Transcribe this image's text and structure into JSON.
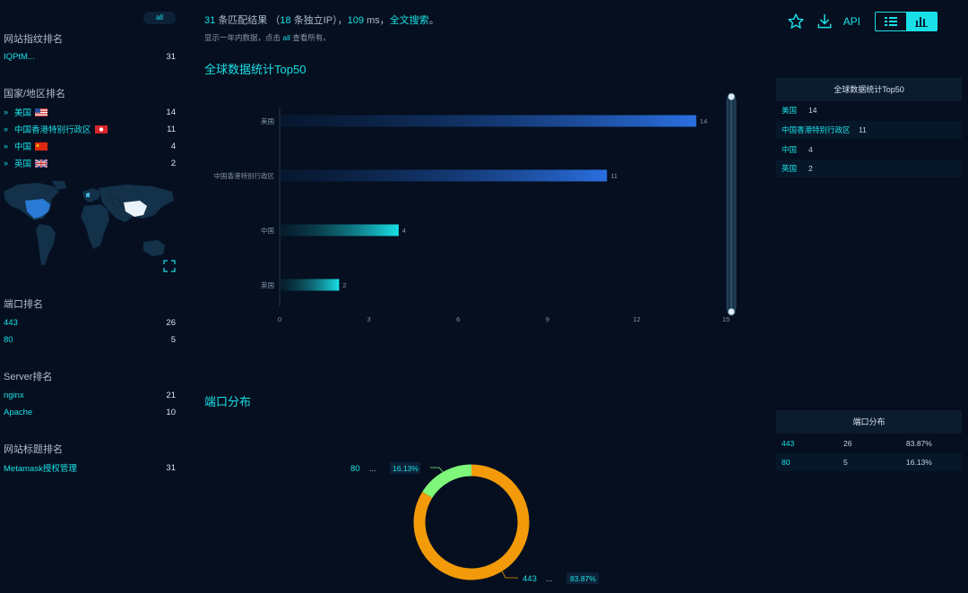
{
  "left": {
    "all_pill": "all",
    "fingerprint": {
      "title": "网站指纹排名",
      "items": [
        {
          "label": "IQPtM...",
          "count": "31"
        }
      ]
    },
    "country": {
      "title": "国家/地区排名",
      "items": [
        {
          "label": "美国",
          "count": "14",
          "flag": "us-flag-icon"
        },
        {
          "label": "中国香港特别行政区",
          "count": "11",
          "flag": "hk-flag-icon"
        },
        {
          "label": "中国",
          "count": "4",
          "flag": "cn-flag-icon"
        },
        {
          "label": "英国",
          "count": "2",
          "flag": "uk-flag-icon"
        }
      ]
    },
    "port": {
      "title": "端口排名",
      "items": [
        {
          "label": "443",
          "count": "26"
        },
        {
          "label": "80",
          "count": "5"
        }
      ]
    },
    "server": {
      "title": "Server排名",
      "items": [
        {
          "label": "nginx",
          "count": "21"
        },
        {
          "label": "Apache",
          "count": "10"
        }
      ]
    },
    "site_title": {
      "title": "网站标题排名",
      "items": [
        {
          "label": "Metamask授权管理",
          "count": "31"
        }
      ]
    }
  },
  "header": {
    "count": "31",
    "matched": "条匹配结果",
    "paren_open": "（",
    "ip_count": "18",
    "ip_text": "条独立IP",
    "paren_close": "）",
    "sep": "，",
    "ms": "109",
    "ms_text": "ms，",
    "fulltext": "全文搜索",
    "end": "。",
    "note_prefix": "显示一年内数据，点击",
    "note_all": "all",
    "note_suffix": "查看所有。"
  },
  "toolbar": {
    "api_label": "API",
    "icons": [
      "star-icon",
      "download-icon",
      "list-view-icon",
      "chart-view-icon"
    ]
  },
  "chart_titles": {
    "global": "全球数据统计Top50",
    "port": "端口分布"
  },
  "chart_data": [
    {
      "type": "bar",
      "orientation": "horizontal",
      "categories": [
        "美国",
        "中国香港特别行政区",
        "中国",
        "英国"
      ],
      "values": [
        14,
        11,
        4,
        2
      ],
      "xticks": [
        0,
        3,
        6,
        9,
        12,
        15
      ],
      "xlim": [
        0,
        15
      ],
      "title": "全球数据统计Top50"
    },
    {
      "type": "pie",
      "donut": true,
      "labels": [
        "443",
        "80"
      ],
      "values": [
        26,
        5
      ],
      "percent_labels": [
        "83.87%",
        "16.13%"
      ],
      "colors": [
        "#f29a09",
        "#7ef77a"
      ],
      "title": "端口分布"
    }
  ],
  "right_tables": {
    "global": {
      "title": "全球数据统计Top50",
      "rows": [
        [
          "美国",
          "14"
        ],
        [
          "中国香港特别行政区",
          "11"
        ],
        [
          "中国",
          "4"
        ],
        [
          "英国",
          "2"
        ]
      ]
    },
    "port": {
      "title": "端口分布",
      "rows": [
        [
          "443",
          "26",
          "83.87%"
        ],
        [
          "80",
          "5",
          "16.13%"
        ]
      ]
    }
  },
  "colors": {
    "accent": "#19e0e6",
    "background": "#050f1f",
    "bar_blue": "#2a6fe0",
    "bar_cyan": "#19e0e6",
    "donut_orange": "#f29a09",
    "donut_green": "#7ef77a"
  },
  "ellipsis": "..."
}
